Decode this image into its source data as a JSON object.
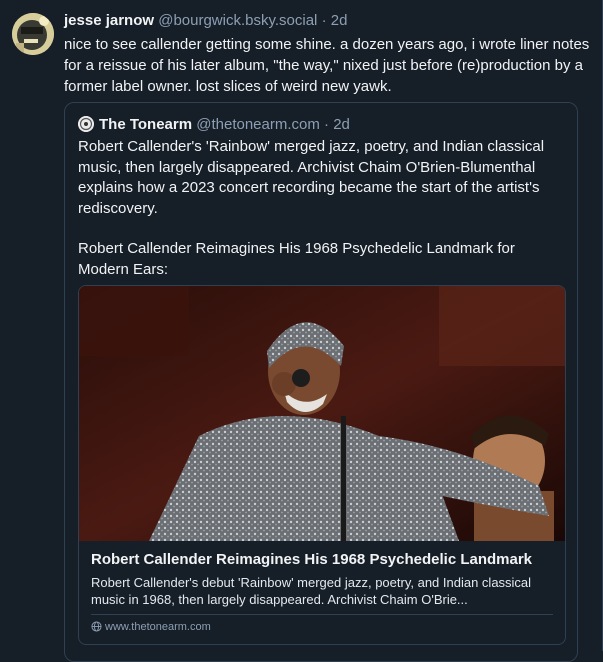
{
  "post": {
    "author_name": "jesse jarnow",
    "author_handle": "@bourgwick.bsky.social",
    "separator": "·",
    "timestamp": "2d",
    "text": "nice to see callender getting some shine. a dozen years ago, i wrote liner notes for a reissue of his later album, \"the way,\" nixed just before (re)production by a former label owner. lost slices of weird new yawk."
  },
  "quote": {
    "author_name": "The Tonearm",
    "author_handle": "@thetonearm.com",
    "separator": "·",
    "timestamp": "2d",
    "text_p1": "Robert Callender's 'Rainbow' merged jazz, poetry, and Indian classical music, then largely disappeared. Archivist Chaim O'Brien-Blumenthal explains how a 2023 concert recording became the start of the artist's rediscovery.",
    "text_p2": "Robert Callender Reimagines His 1968 Psychedelic Landmark for Modern Ears:",
    "card": {
      "title": "Robert Callender Reimagines His 1968 Psychedelic Landmark",
      "description": "Robert Callender's debut 'Rainbow' merged jazz, poetry, and Indian classical music in 1968, then largely disappeared. Archivist Chaim O'Brie...",
      "domain": "www.thetonearm.com",
      "globe_icon": "globe-icon"
    }
  },
  "colors": {
    "background": "#161e27",
    "border": "#2e4052",
    "muted_text": "#8d9fb4",
    "primary_text": "#f1f3f5"
  }
}
